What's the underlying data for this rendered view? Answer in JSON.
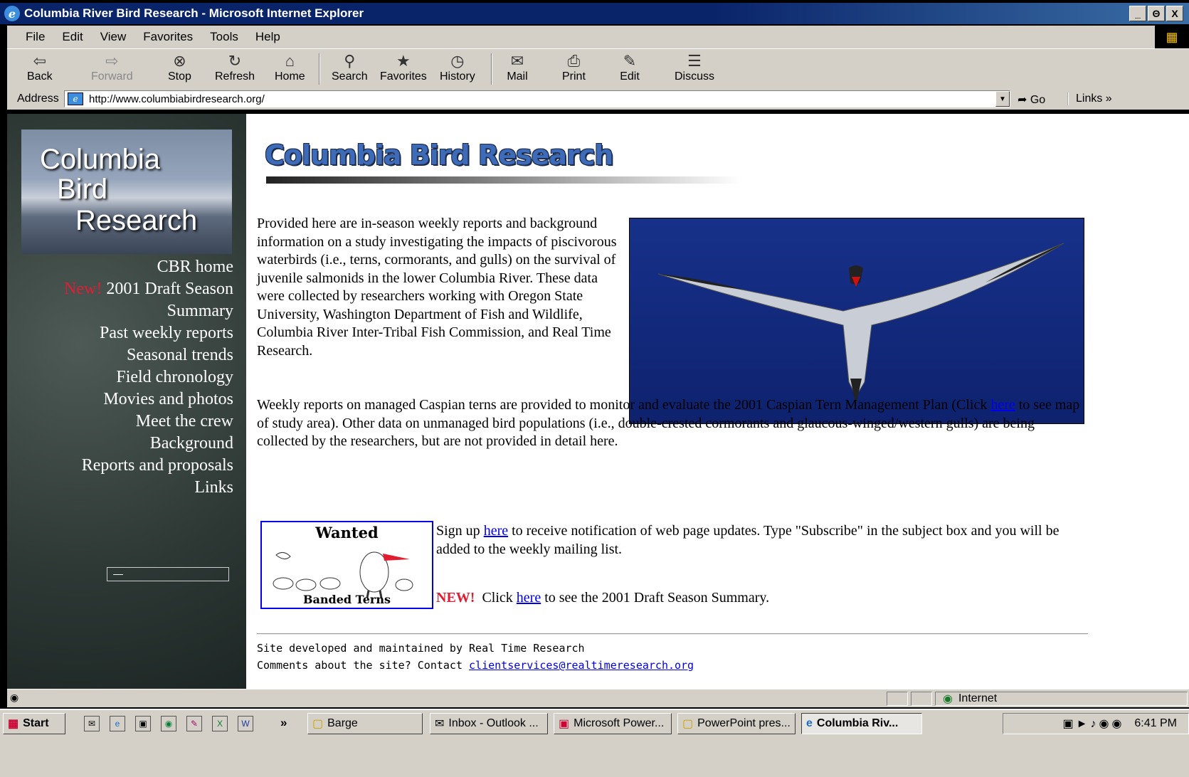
{
  "window": {
    "title": "Columbia River Bird Research - Microsoft Internet Explorer",
    "buttons": [
      "_",
      "Θ",
      "X"
    ]
  },
  "menu": [
    "File",
    "Edit",
    "View",
    "Favorites",
    "Tools",
    "Help"
  ],
  "toolbar": {
    "back": "Back",
    "forward": "Forward",
    "stop": "Stop",
    "refresh": "Refresh",
    "home": "Home",
    "search": "Search",
    "favorites": "Favorites",
    "history": "History",
    "mail": "Mail",
    "print": "Print",
    "edit": "Edit",
    "discuss": "Discuss"
  },
  "address": {
    "label": "Address",
    "url": "http://www.columbiabirdresearch.org/",
    "go": "Go",
    "links": "Links"
  },
  "sidebar": {
    "logo": [
      "Columbia",
      "Bird",
      "Research"
    ],
    "new_tag": "New!",
    "items": [
      "CBR home",
      "2001 Draft Season",
      "Summary",
      "Past weekly reports",
      "Seasonal trends",
      "Field chronology",
      "Movies and photos",
      "Meet the crew",
      "Background",
      "Reports and proposals",
      "Links"
    ],
    "box_text": "—"
  },
  "main": {
    "banner": "Columbia Bird Research",
    "intro": "Provided here are in-season weekly reports and background information on a study investigating the impacts of piscivorous waterbirds (i.e., terns, cormorants, and gulls) on the survival of juvenile salmonids in the lower Columbia River. These data were collected by researchers working with Oregon State University, Washington Department of Fish and Wildlife, Columbia River Inter-Tribal Fish Commission, and Real Time Research.",
    "weekly_a": "Weekly reports on managed Caspian terns are provided to monitor and evaluate the 2001 Caspian Tern Management Plan (Click ",
    "here": "here",
    "weekly_b": " to see map of study area). Other data on unmanaged bird populations (i.e., double-crested cormorants and glaucous-winged/western gulls) are being collected by the researchers, but are not provided in detail here.",
    "wanted_top": "Wanted",
    "wanted_bottom": "Banded Terns",
    "signup_a": "Sign up ",
    "signup_b": " to receive notification of web page updates. Type \"Subscribe\" in the subject box and you will be added to the weekly mailing list.",
    "new_label": "NEW!",
    "summary_a": "  Click ",
    "summary_b": " to see the 2001 Draft Season Summary.",
    "footer1": "Site developed and maintained by Real Time Research",
    "footer2": "Comments about the site? Contact ",
    "email": "clientservices@realtimeresearch.org"
  },
  "status": {
    "zone": "Internet"
  },
  "taskbar": {
    "start": "Start",
    "more": "»",
    "tasks": [
      "Barge",
      "Inbox - Outlook ...",
      "Microsoft Power...",
      "PowerPoint pres...",
      "Columbia Riv..."
    ],
    "clock": "6:41 PM"
  }
}
